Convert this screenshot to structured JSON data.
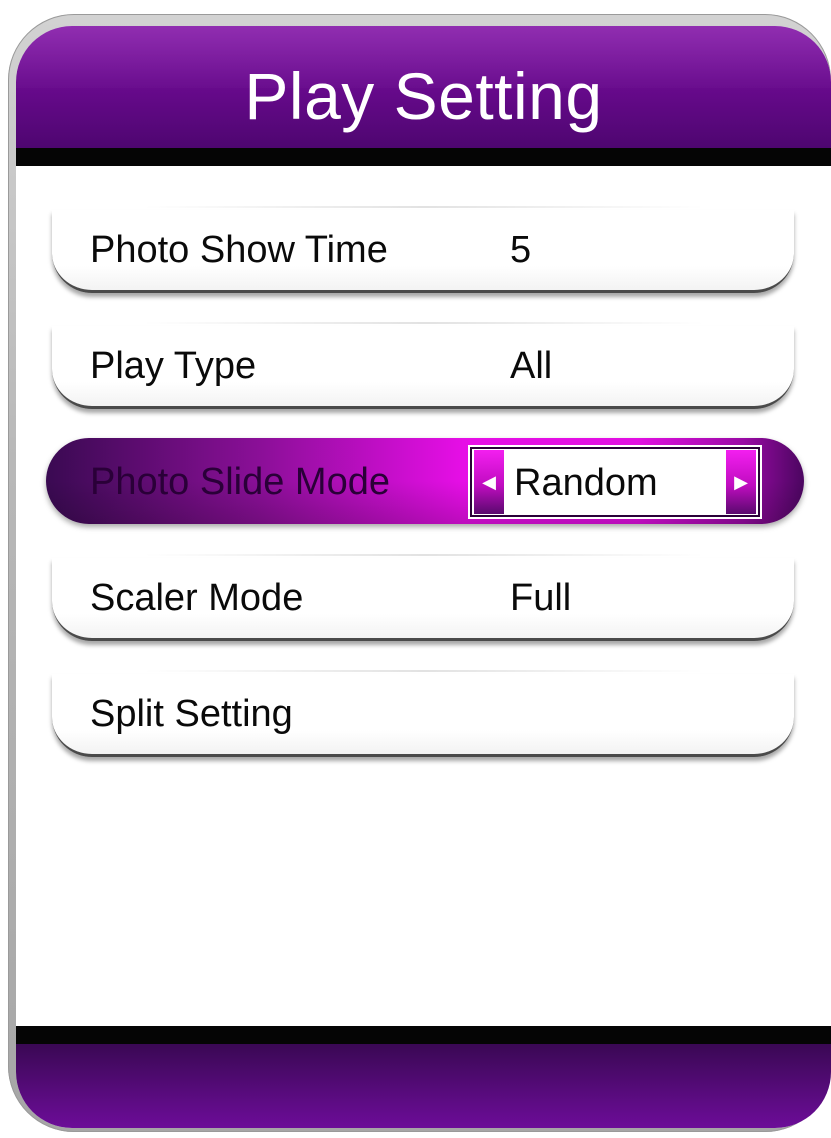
{
  "title": "Play Setting",
  "menu": {
    "items": [
      {
        "label": "Photo Show Time",
        "value": "5"
      },
      {
        "label": "Play Type",
        "value": "All"
      },
      {
        "label": "Photo Slide Mode",
        "value": "Random",
        "selected": true
      },
      {
        "label": "Scaler Mode",
        "value": "Full"
      },
      {
        "label": "Split Setting",
        "value": ""
      }
    ]
  },
  "icons": {
    "left_arrow": "arrow-left-icon",
    "right_arrow": "arrow-right-icon"
  },
  "colors": {
    "header": "#6a0a8f",
    "highlight": "#e60ee6",
    "footer": "#560b7a",
    "frame": "#b8b8b8"
  }
}
